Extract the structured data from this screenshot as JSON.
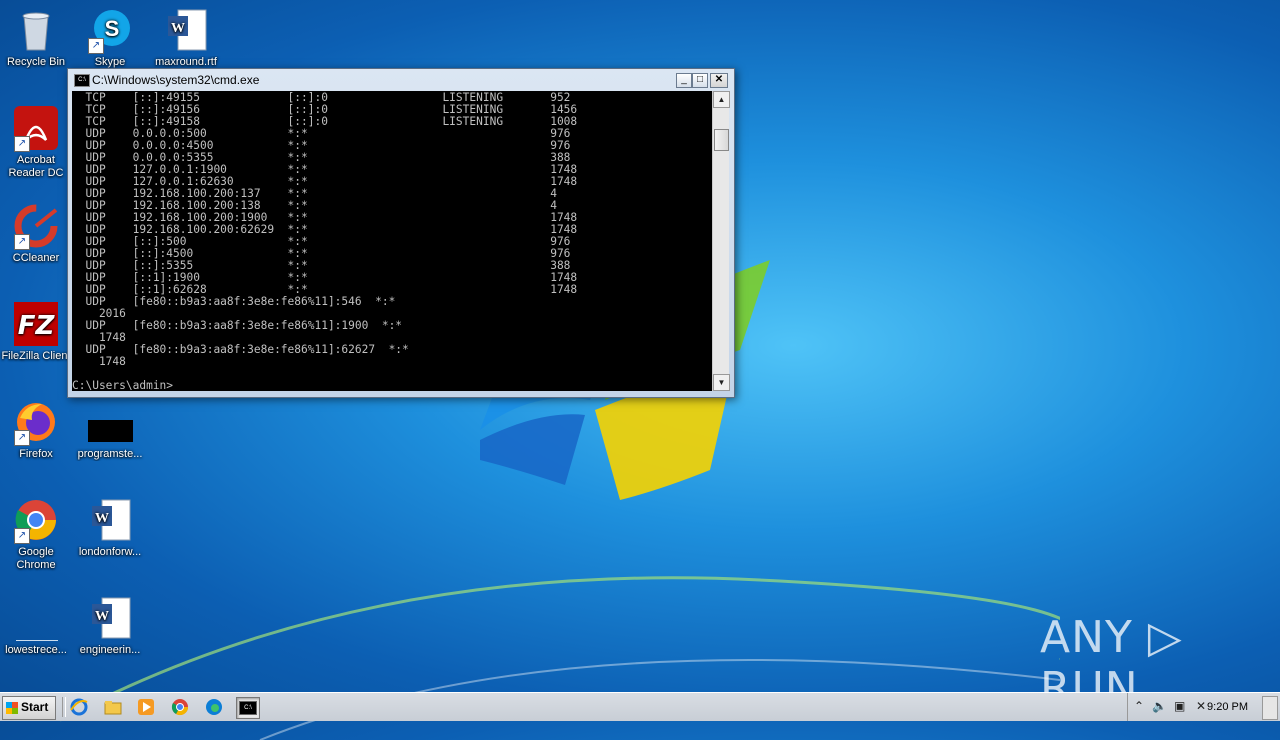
{
  "desktop": {
    "icons": [
      {
        "label": "Recycle Bin"
      },
      {
        "label": "Skype"
      },
      {
        "label": "maxround.rtf"
      },
      {
        "label": "Acrobat Reader DC"
      },
      {
        "label": "CCleaner"
      },
      {
        "label": "FileZilla Client"
      },
      {
        "label": "Firefox"
      },
      {
        "label": "programste..."
      },
      {
        "label": "Google Chrome"
      },
      {
        "label": "londonforw..."
      },
      {
        "label": "lowestrece..."
      },
      {
        "label": "engineerin..."
      }
    ]
  },
  "cmd": {
    "title": "C:\\Windows\\system32\\cmd.exe",
    "icon_text": "C:\\",
    "output": "  TCP    [::]:49155             [::]:0                 LISTENING       952\n  TCP    [::]:49156             [::]:0                 LISTENING       1456\n  TCP    [::]:49158             [::]:0                 LISTENING       1008\n  UDP    0.0.0.0:500            *:*                                    976\n  UDP    0.0.0.0:4500           *:*                                    976\n  UDP    0.0.0.0:5355           *:*                                    388\n  UDP    127.0.0.1:1900         *:*                                    1748\n  UDP    127.0.0.1:62630        *:*                                    1748\n  UDP    192.168.100.200:137    *:*                                    4\n  UDP    192.168.100.200:138    *:*                                    4\n  UDP    192.168.100.200:1900   *:*                                    1748\n  UDP    192.168.100.200:62629  *:*                                    1748\n  UDP    [::]:500               *:*                                    976\n  UDP    [::]:4500              *:*                                    976\n  UDP    [::]:5355              *:*                                    388\n  UDP    [::1]:1900             *:*                                    1748\n  UDP    [::1]:62628            *:*                                    1748\n  UDP    [fe80::b9a3:aa8f:3e8e:fe86%11]:546  *:*\n    2016\n  UDP    [fe80::b9a3:aa8f:3e8e:fe86%11]:1900  *:*\n    1748\n  UDP    [fe80::b9a3:aa8f:3e8e:fe86%11]:62627  *:*\n    1748\n\nC:\\Users\\admin>",
    "minimize": "_",
    "maximize": "□",
    "close": "✕"
  },
  "taskbar": {
    "start_label": "Start",
    "pinned": [
      {
        "icon": "ie-icon"
      },
      {
        "icon": "explorer-icon"
      },
      {
        "icon": "media-player-icon"
      },
      {
        "icon": "chrome-icon"
      },
      {
        "icon": "edge-icon"
      },
      {
        "icon": "cmd-icon"
      }
    ],
    "clock": "9:20 PM"
  },
  "watermark": "ANY ▷ RUN",
  "colors": {
    "desktop_blue": "#1e90dd",
    "console_bg": "#000000",
    "console_fg": "#c0c0c0"
  }
}
